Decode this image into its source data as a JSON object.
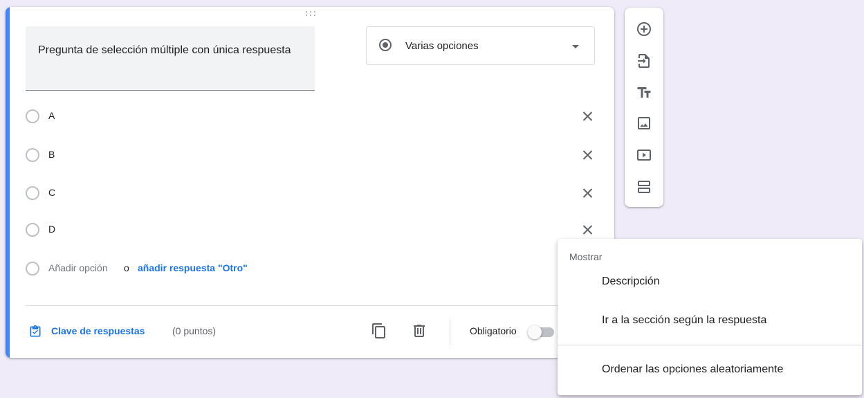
{
  "question": {
    "title": "Pregunta de selección múltiple con única respuesta",
    "type_label": "Varias opciones",
    "options": [
      "A",
      "B",
      "C",
      "D"
    ],
    "add_option": "Añadir opción",
    "or_text": "o",
    "add_other": "añadir respuesta \"Otro\""
  },
  "footer": {
    "answer_key": "Clave de respuestas",
    "points": "(0 puntos)",
    "required": "Obligatorio",
    "required_on": false
  },
  "side_toolbar": {
    "tools": [
      "add-question-icon",
      "import-questions-icon",
      "add-title-icon",
      "add-image-icon",
      "add-video-icon",
      "add-section-icon"
    ]
  },
  "menu": {
    "header": "Mostrar",
    "items": [
      "Descripción",
      "Ir a la sección según la respuesta",
      "Ordenar las opciones aleatoriamente"
    ]
  },
  "colors": {
    "accent": "#4285f4",
    "link": "#1a73e8",
    "background": "#f0ebf8"
  }
}
